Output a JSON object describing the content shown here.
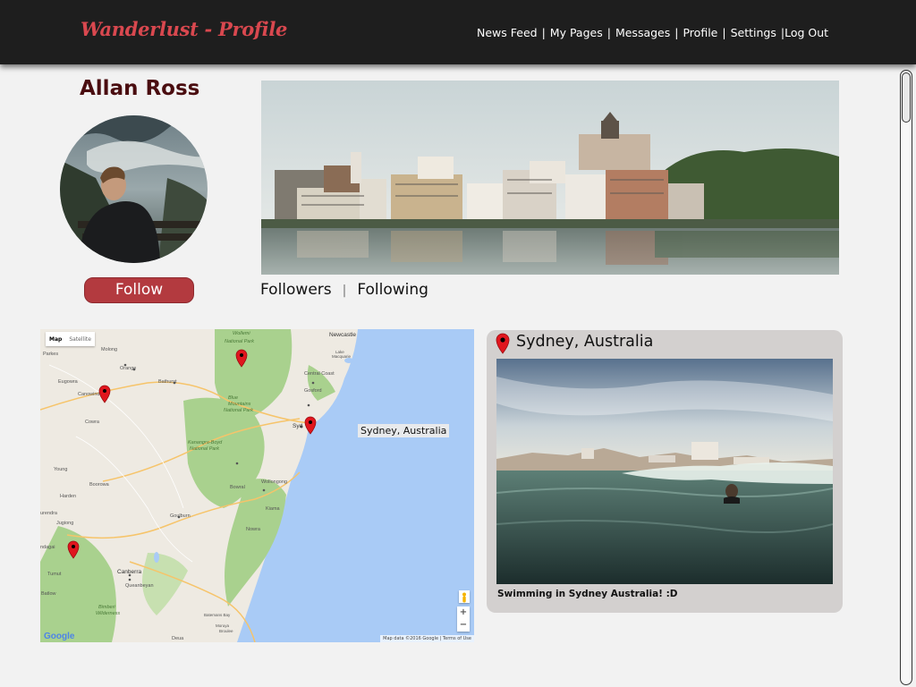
{
  "header": {
    "brand": "Wanderlust - Profile",
    "nav": [
      {
        "label": "News Feed"
      },
      {
        "label": "My Pages"
      },
      {
        "label": "Messages"
      },
      {
        "label": "Profile"
      },
      {
        "label": "Settings"
      },
      {
        "label": "Log Out"
      }
    ]
  },
  "profile": {
    "name": "Allan Ross",
    "follow_label": "Follow",
    "followers_label": "Followers",
    "divider": "|",
    "following_label": "Following"
  },
  "map": {
    "type_options": [
      "Map",
      "Satellite"
    ],
    "selected_type": "Map",
    "pin_label": "Sydney, Australia",
    "place_labels": [
      "Mudgee",
      "Wollemi National Park",
      "Newcastle",
      "Lake Macquarie",
      "Parkes",
      "Molong",
      "Orange",
      "Bathurst",
      "Central Coast",
      "Gosford",
      "Eugowra",
      "Canowindra",
      "Blue Mountains National Park",
      "Cowra",
      "Sydney",
      "Kanangra-Boyd National Park",
      "Young",
      "Boorowa",
      "Bowral",
      "Wollongong",
      "Harden",
      "Goulburn",
      "Kiama",
      "Jugiong",
      "Nowra",
      "Gundagai",
      "Tumut",
      "Canberra",
      "Queanbeyan",
      "Batlow",
      "Bimberi Wilderness",
      "Batemans Bay",
      "Moruya",
      "Broulee",
      "Deua"
    ],
    "zoom_in": "+",
    "zoom_out": "−",
    "logo": "Google",
    "attribution": "Map data ©2016 Google | Terms of Use"
  },
  "post": {
    "location": "Sydney, Australia",
    "caption": "Swimming in Sydney Australia! :D"
  },
  "colors": {
    "header_bg": "#1e1e1e",
    "brand": "#d9484f",
    "name": "#4a0d10",
    "follow_button": "#b33a3f",
    "card_bg": "#d3d0cf",
    "pin": "#e0161e"
  }
}
